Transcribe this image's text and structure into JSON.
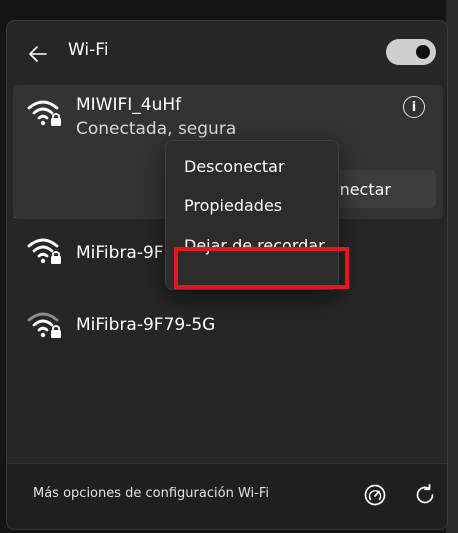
{
  "header": {
    "title": "Wi-Fi",
    "wifi_enabled": true
  },
  "networks": [
    {
      "name": "MIWIFI_4uHf",
      "status": "Conectada, segura",
      "action_label": "Desconectar",
      "action_visible_text": "nectar"
    },
    {
      "name": "MiFibra-9F79",
      "visible_name": "MiFibra-9F7"
    },
    {
      "name": "MiFibra-9F79-5G"
    }
  ],
  "context_menu": {
    "items": [
      {
        "label": "Desconectar"
      },
      {
        "label": "Propiedades"
      },
      {
        "label": "Dejar de recordar",
        "highlighted": true
      }
    ]
  },
  "footer": {
    "settings_link": "Más opciones de configuración Wi-Fi"
  },
  "colors": {
    "highlight": "#e3161f",
    "panel": "#262626",
    "selected_row": "#333333"
  },
  "icons": [
    "back-arrow-icon",
    "toggle-switch",
    "wifi-secure-icon",
    "info-icon",
    "speedometer-icon",
    "refresh-icon"
  ]
}
